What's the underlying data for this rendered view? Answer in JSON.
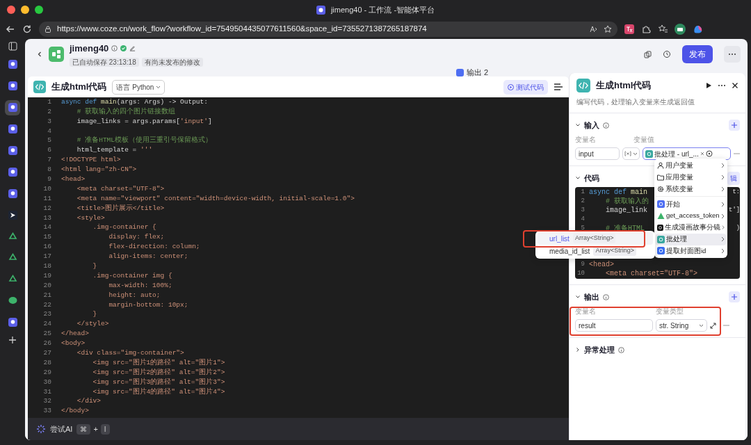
{
  "browser": {
    "title": "jimeng40 - 工作流 -智能体平台",
    "url": "https://www.coze.cn/work_flow?workflow_id=7549504435077611560&space_id=7355271387265187874"
  },
  "vertical_tabs": [
    {
      "kind": "coze",
      "selected": false
    },
    {
      "kind": "coze",
      "selected": false
    },
    {
      "kind": "coze",
      "selected": true
    },
    {
      "kind": "coze",
      "selected": false
    },
    {
      "kind": "coze",
      "selected": false
    },
    {
      "kind": "coze",
      "selected": false
    },
    {
      "kind": "coze",
      "selected": false
    },
    {
      "kind": "arrow",
      "selected": false
    },
    {
      "kind": "recycle",
      "selected": false
    },
    {
      "kind": "recycle",
      "selected": false
    },
    {
      "kind": "recycle",
      "selected": false
    },
    {
      "kind": "chat",
      "selected": false
    },
    {
      "kind": "coze",
      "selected": false
    }
  ],
  "workflow": {
    "name": "jimeng40",
    "badges": [
      "已自动保存 23:13:18",
      "有尚未发布的修改"
    ],
    "publish_button": "发布"
  },
  "canvas": {
    "node_label": "输出 2"
  },
  "code_editor": {
    "title": "生成html代码",
    "language": "语言 Python",
    "test_button": "测试代码",
    "lines": [
      {
        "n": "1",
        "parts": [
          {
            "text": "async def ",
            "kind": "keyword"
          },
          {
            "text": "main",
            "kind": "function"
          },
          {
            "text": "(args: Args) -> Output:",
            "kind": "plain"
          }
        ]
      },
      {
        "n": "2",
        "parts": [
          {
            "text": "    # 获取输入的四个图片链接数组",
            "kind": "comment"
          }
        ]
      },
      {
        "n": "3",
        "parts": [
          {
            "text": "    image_links = args.params[",
            "kind": "plain"
          },
          {
            "text": "'input'",
            "kind": "string"
          },
          {
            "text": "]",
            "kind": "plain"
          }
        ]
      },
      {
        "n": "4"
      },
      {
        "n": "5",
        "parts": [
          {
            "text": "    # 准备HTML模板（使用三重引号保留格式）",
            "kind": "comment"
          }
        ]
      },
      {
        "n": "6",
        "parts": [
          {
            "text": "    html_template = ",
            "kind": "plain"
          },
          {
            "text": "'''",
            "kind": "string"
          }
        ]
      },
      {
        "n": "7",
        "parts": [
          {
            "text": "<!DOCTYPE html>",
            "kind": "string"
          }
        ]
      },
      {
        "n": "8",
        "parts": [
          {
            "text": "<html lang=\"zh-CN\">",
            "kind": "string"
          }
        ]
      },
      {
        "n": "9",
        "parts": [
          {
            "text": "<head>",
            "kind": "string"
          }
        ]
      },
      {
        "n": "10",
        "parts": [
          {
            "text": "    <meta charset=\"UTF-8\">",
            "kind": "string"
          }
        ]
      },
      {
        "n": "11",
        "parts": [
          {
            "text": "    <meta name=\"viewport\" content=\"width=device-width, initial-scale=1.0\">",
            "kind": "string"
          }
        ]
      },
      {
        "n": "12",
        "parts": [
          {
            "text": "    <title>图片展示</title>",
            "kind": "string"
          }
        ]
      },
      {
        "n": "13",
        "parts": [
          {
            "text": "    <style>",
            "kind": "string"
          }
        ]
      },
      {
        "n": "14",
        "parts": [
          {
            "text": "        .img-container {",
            "kind": "string"
          }
        ]
      },
      {
        "n": "15",
        "parts": [
          {
            "text": "            display: flex;",
            "kind": "string"
          }
        ]
      },
      {
        "n": "16",
        "parts": [
          {
            "text": "            flex-direction: column;",
            "kind": "string"
          }
        ]
      },
      {
        "n": "17",
        "parts": [
          {
            "text": "            align-items: center;",
            "kind": "string"
          }
        ]
      },
      {
        "n": "18",
        "parts": [
          {
            "text": "        }",
            "kind": "string"
          }
        ]
      },
      {
        "n": "19",
        "parts": [
          {
            "text": "        .img-container img {",
            "kind": "string"
          }
        ]
      },
      {
        "n": "20",
        "parts": [
          {
            "text": "            max-width: 100%;",
            "kind": "string"
          }
        ]
      },
      {
        "n": "21",
        "parts": [
          {
            "text": "            height: auto;",
            "kind": "string"
          }
        ]
      },
      {
        "n": "22",
        "parts": [
          {
            "text": "            margin-bottom: 10px;",
            "kind": "string"
          }
        ]
      },
      {
        "n": "23",
        "parts": [
          {
            "text": "        }",
            "kind": "string"
          }
        ]
      },
      {
        "n": "24",
        "parts": [
          {
            "text": "    </style>",
            "kind": "string"
          }
        ]
      },
      {
        "n": "25",
        "parts": [
          {
            "text": "</head>",
            "kind": "string"
          }
        ]
      },
      {
        "n": "26",
        "parts": [
          {
            "text": "<body>",
            "kind": "string"
          }
        ]
      },
      {
        "n": "27",
        "parts": [
          {
            "text": "    <div class=\"img-container\">",
            "kind": "string"
          }
        ]
      },
      {
        "n": "28",
        "parts": [
          {
            "text": "        <img src=\"图片1的路径\" alt=\"图片1\">",
            "kind": "string"
          }
        ]
      },
      {
        "n": "29",
        "parts": [
          {
            "text": "        <img src=\"图片2的路径\" alt=\"图片2\">",
            "kind": "string"
          }
        ]
      },
      {
        "n": "30",
        "parts": [
          {
            "text": "        <img src=\"图片3的路径\" alt=\"图片3\">",
            "kind": "string"
          }
        ]
      },
      {
        "n": "31",
        "parts": [
          {
            "text": "        <img src=\"图片4的路径\" alt=\"图片4\">",
            "kind": "string"
          }
        ]
      },
      {
        "n": "32",
        "parts": [
          {
            "text": "    </div>",
            "kind": "string"
          }
        ]
      },
      {
        "n": "33",
        "parts": [
          {
            "text": "</body>",
            "kind": "string"
          }
        ]
      }
    ],
    "ai_bar": {
      "label": "尝试AI",
      "keys": [
        "⌘",
        "I"
      ],
      "plus": "+"
    }
  },
  "node_panel": {
    "title": "生成html代码",
    "description": "编写代码，处理输入变量来生成返回值",
    "input": {
      "title": "输入",
      "expanded": true,
      "columns": [
        "变量名",
        "变量值"
      ],
      "rows": [
        {
          "name": "input",
          "value": "批处理 - url_...",
          "color": "#3aa8a0"
        }
      ]
    },
    "code": {
      "title": "代码",
      "expanded": true,
      "edit_button": "辑",
      "lines": [
        {
          "n": "1",
          "parts": [
            {
              "text": "async def ",
              "kind": "keyword"
            },
            {
              "text": "main",
              "kind": "function"
            }
          ],
          "tail": "t:"
        },
        {
          "n": "2",
          "parts": [
            {
              "text": "    # 获取输入的",
              "kind": "comment"
            }
          ]
        },
        {
          "n": "3",
          "parts": [
            {
              "text": "    image_link",
              "kind": "plain"
            }
          ],
          "tail": "t']"
        },
        {
          "n": "4"
        },
        {
          "n": "5",
          "parts": [
            {
              "text": "    # 准备HTML",
              "kind": "comment"
            }
          ],
          "tail": ")"
        },
        {
          "n": "9",
          "parts": [
            {
              "text": "<head>",
              "kind": "string"
            }
          ]
        },
        {
          "n": "10",
          "parts": [
            {
              "text": "    <meta charset=\"UTF-8\">",
              "kind": "string"
            }
          ]
        }
      ]
    },
    "output": {
      "title": "输出",
      "expanded": true,
      "columns": [
        "变量名",
        "变量类型"
      ],
      "rows": [
        {
          "name": "result",
          "type": "str. String",
          "highlighted": true
        }
      ]
    },
    "error_handling": {
      "title": "异常处理",
      "expanded": false
    }
  },
  "variable_menu": {
    "items": [
      {
        "label": "用户变量",
        "kind": "user",
        "selected": false
      },
      {
        "label": "应用变量",
        "kind": "app",
        "selected": false
      },
      {
        "label": "系统变量",
        "kind": "system",
        "selected": false
      },
      {
        "label": "开始",
        "kind": "node",
        "color": "#4e6ef2",
        "selected": false
      },
      {
        "label": "get_access_token",
        "kind": "plugin",
        "color": "#3db36b",
        "selected": false
      },
      {
        "label": "生成漫画故事分镜",
        "kind": "node",
        "color": "#111111",
        "selected": false
      },
      {
        "label": "批处理",
        "kind": "node",
        "color": "#3aa8a0",
        "selected": true
      },
      {
        "label": "提取封面图id",
        "kind": "node",
        "color": "#3c6ef0",
        "selected": false
      }
    ],
    "submenu": [
      {
        "label": "url_list",
        "type": "Array<String>",
        "selected": true,
        "highlighted": true
      },
      {
        "label": "media_id_list",
        "type": "Array<String>",
        "selected": false,
        "highlighted": false
      }
    ]
  }
}
